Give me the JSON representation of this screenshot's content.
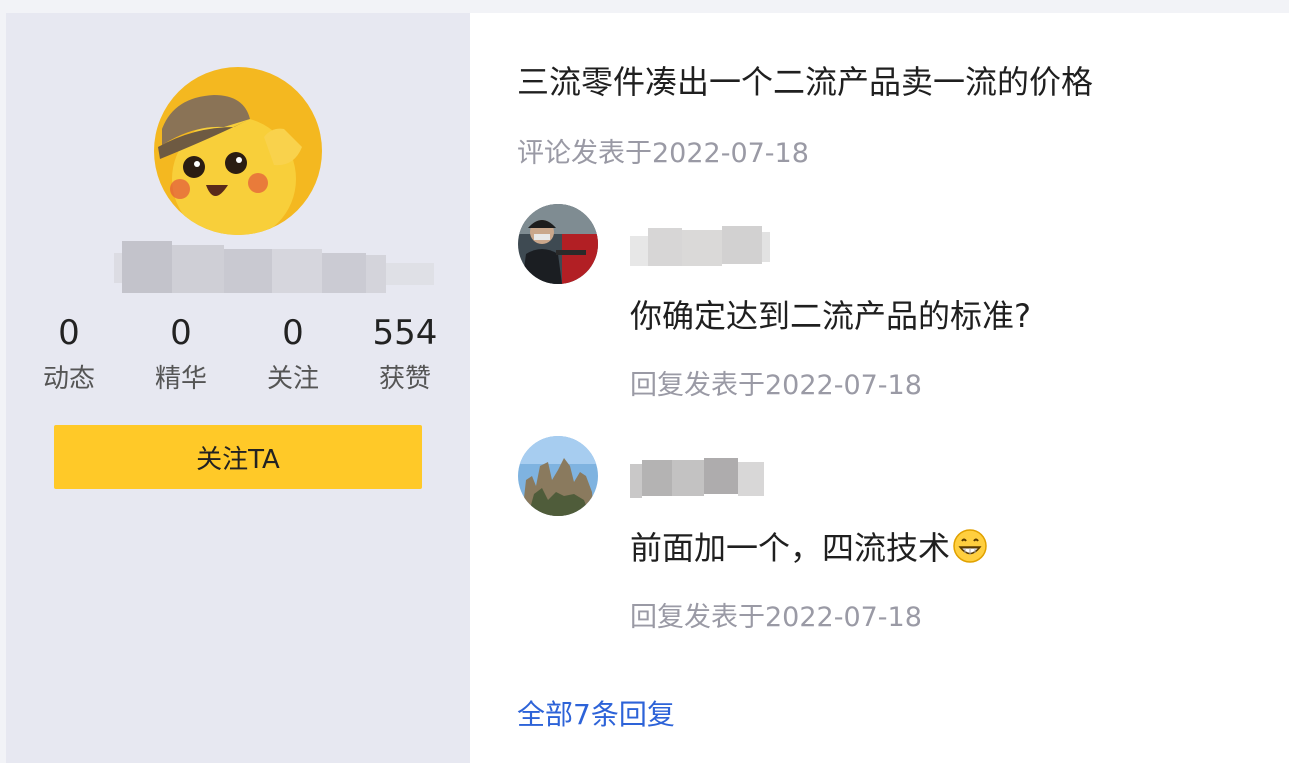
{
  "profile": {
    "stats": [
      {
        "value": "0",
        "label": "动态"
      },
      {
        "value": "0",
        "label": "精华"
      },
      {
        "value": "0",
        "label": "关注"
      },
      {
        "value": "554",
        "label": "获赞"
      }
    ],
    "follow_label": "关注TA"
  },
  "post": {
    "title": "三流零件凑出一个二流产品卖一流的价格",
    "meta": "评论发表于2022-07-18"
  },
  "replies": [
    {
      "text": "你确定达到二流产品的标准?",
      "meta": "回复发表于2022-07-18"
    },
    {
      "text": "前面加一个，四流技术",
      "meta": "回复发表于2022-07-18",
      "emoji": "grinning-face-icon"
    }
  ],
  "all_replies_label": "全部7条回复",
  "colors": {
    "accent": "#ffc928",
    "link": "#2d63d8",
    "sidebar_bg": "#e7e8f1",
    "meta_text": "#9a9aa5"
  }
}
